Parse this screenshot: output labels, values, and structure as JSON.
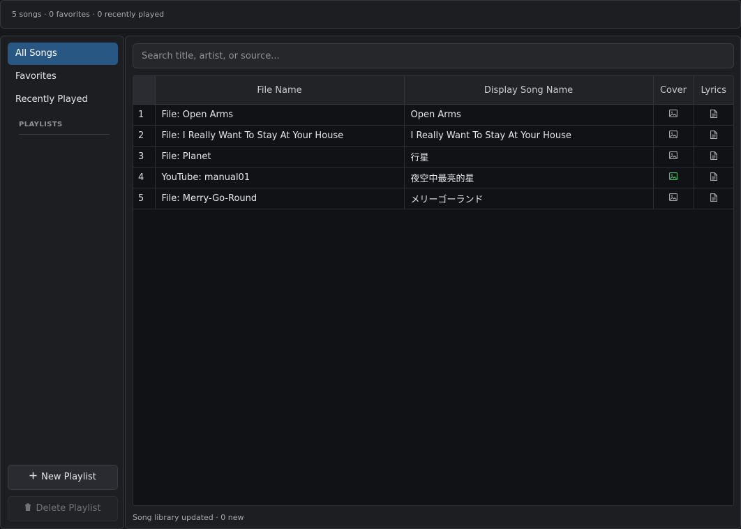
{
  "header": {
    "summary": "5 songs · 0 favorites · 0 recently played"
  },
  "sidebar": {
    "nav": [
      {
        "label": "All Songs",
        "active": true
      },
      {
        "label": "Favorites",
        "active": false
      },
      {
        "label": "Recently Played",
        "active": false
      }
    ],
    "playlists_label": "PLAYLISTS",
    "new_playlist_label": "New Playlist",
    "delete_playlist_label": "Delete Playlist"
  },
  "search": {
    "placeholder": "Search title, artist, or source...",
    "value": ""
  },
  "table": {
    "columns": [
      "File Name",
      "Display Song Name",
      "Cover",
      "Lyrics"
    ],
    "rows": [
      {
        "index": "1",
        "file_name": "File: Open Arms",
        "display_name": "Open Arms",
        "cover_icon": "image-icon",
        "cover_active": false,
        "lyrics_icon": "document-icon"
      },
      {
        "index": "2",
        "file_name": "File: I Really Want To Stay At Your House",
        "display_name": "I Really Want To Stay At Your House",
        "cover_icon": "image-icon",
        "cover_active": false,
        "lyrics_icon": "document-icon"
      },
      {
        "index": "3",
        "file_name": "File: Planet",
        "display_name": "行星",
        "cover_icon": "image-icon",
        "cover_active": false,
        "lyrics_icon": "document-icon"
      },
      {
        "index": "4",
        "file_name": "YouTube: manual01",
        "display_name": "夜空中最亮的星",
        "cover_icon": "image-icon",
        "cover_active": true,
        "lyrics_icon": "document-icon"
      },
      {
        "index": "5",
        "file_name": "File: Merry-Go-Round",
        "display_name": "メリーゴーランド",
        "cover_icon": "image-icon",
        "cover_active": false,
        "lyrics_icon": "document-icon"
      }
    ]
  },
  "status": {
    "text": "Song library updated · 0 new"
  },
  "colors": {
    "accent": "#295784",
    "cover_active": "#4cc46c",
    "icon_default": "#a8abb0"
  }
}
